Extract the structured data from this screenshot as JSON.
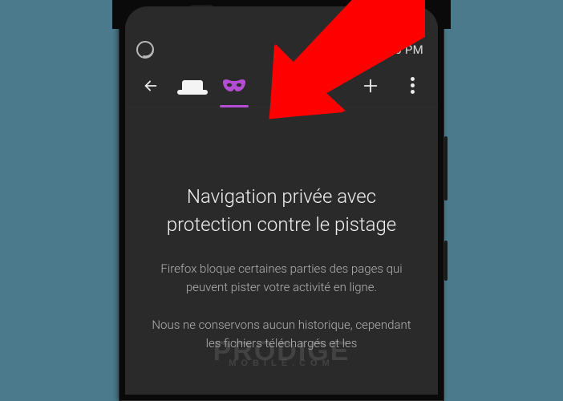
{
  "status_bar": {
    "time": "4:56 PM"
  },
  "toolbar": {
    "back_label": "Back",
    "normal_tab_label": "Normal tabs",
    "private_tab_label": "Private tabs",
    "new_tab_label": "New tab",
    "menu_label": "Menu"
  },
  "content": {
    "heading": "Navigation privée avec protection contre le pistage",
    "paragraph1": "Firefox bloque certaines parties des pages qui peuvent pister votre activité en ligne.",
    "paragraph2": "Nous ne conservons aucun historique, cependant les fichiers téléchargés et les"
  },
  "watermark": {
    "line1": "PRODIGE",
    "line2": "MOBILE.COM"
  },
  "colors": {
    "accent": "#b54dd4",
    "bg": "#2b2a2a",
    "arrow": "#ff0000"
  },
  "annotation": {
    "arrow_points_to": "private-tab"
  }
}
